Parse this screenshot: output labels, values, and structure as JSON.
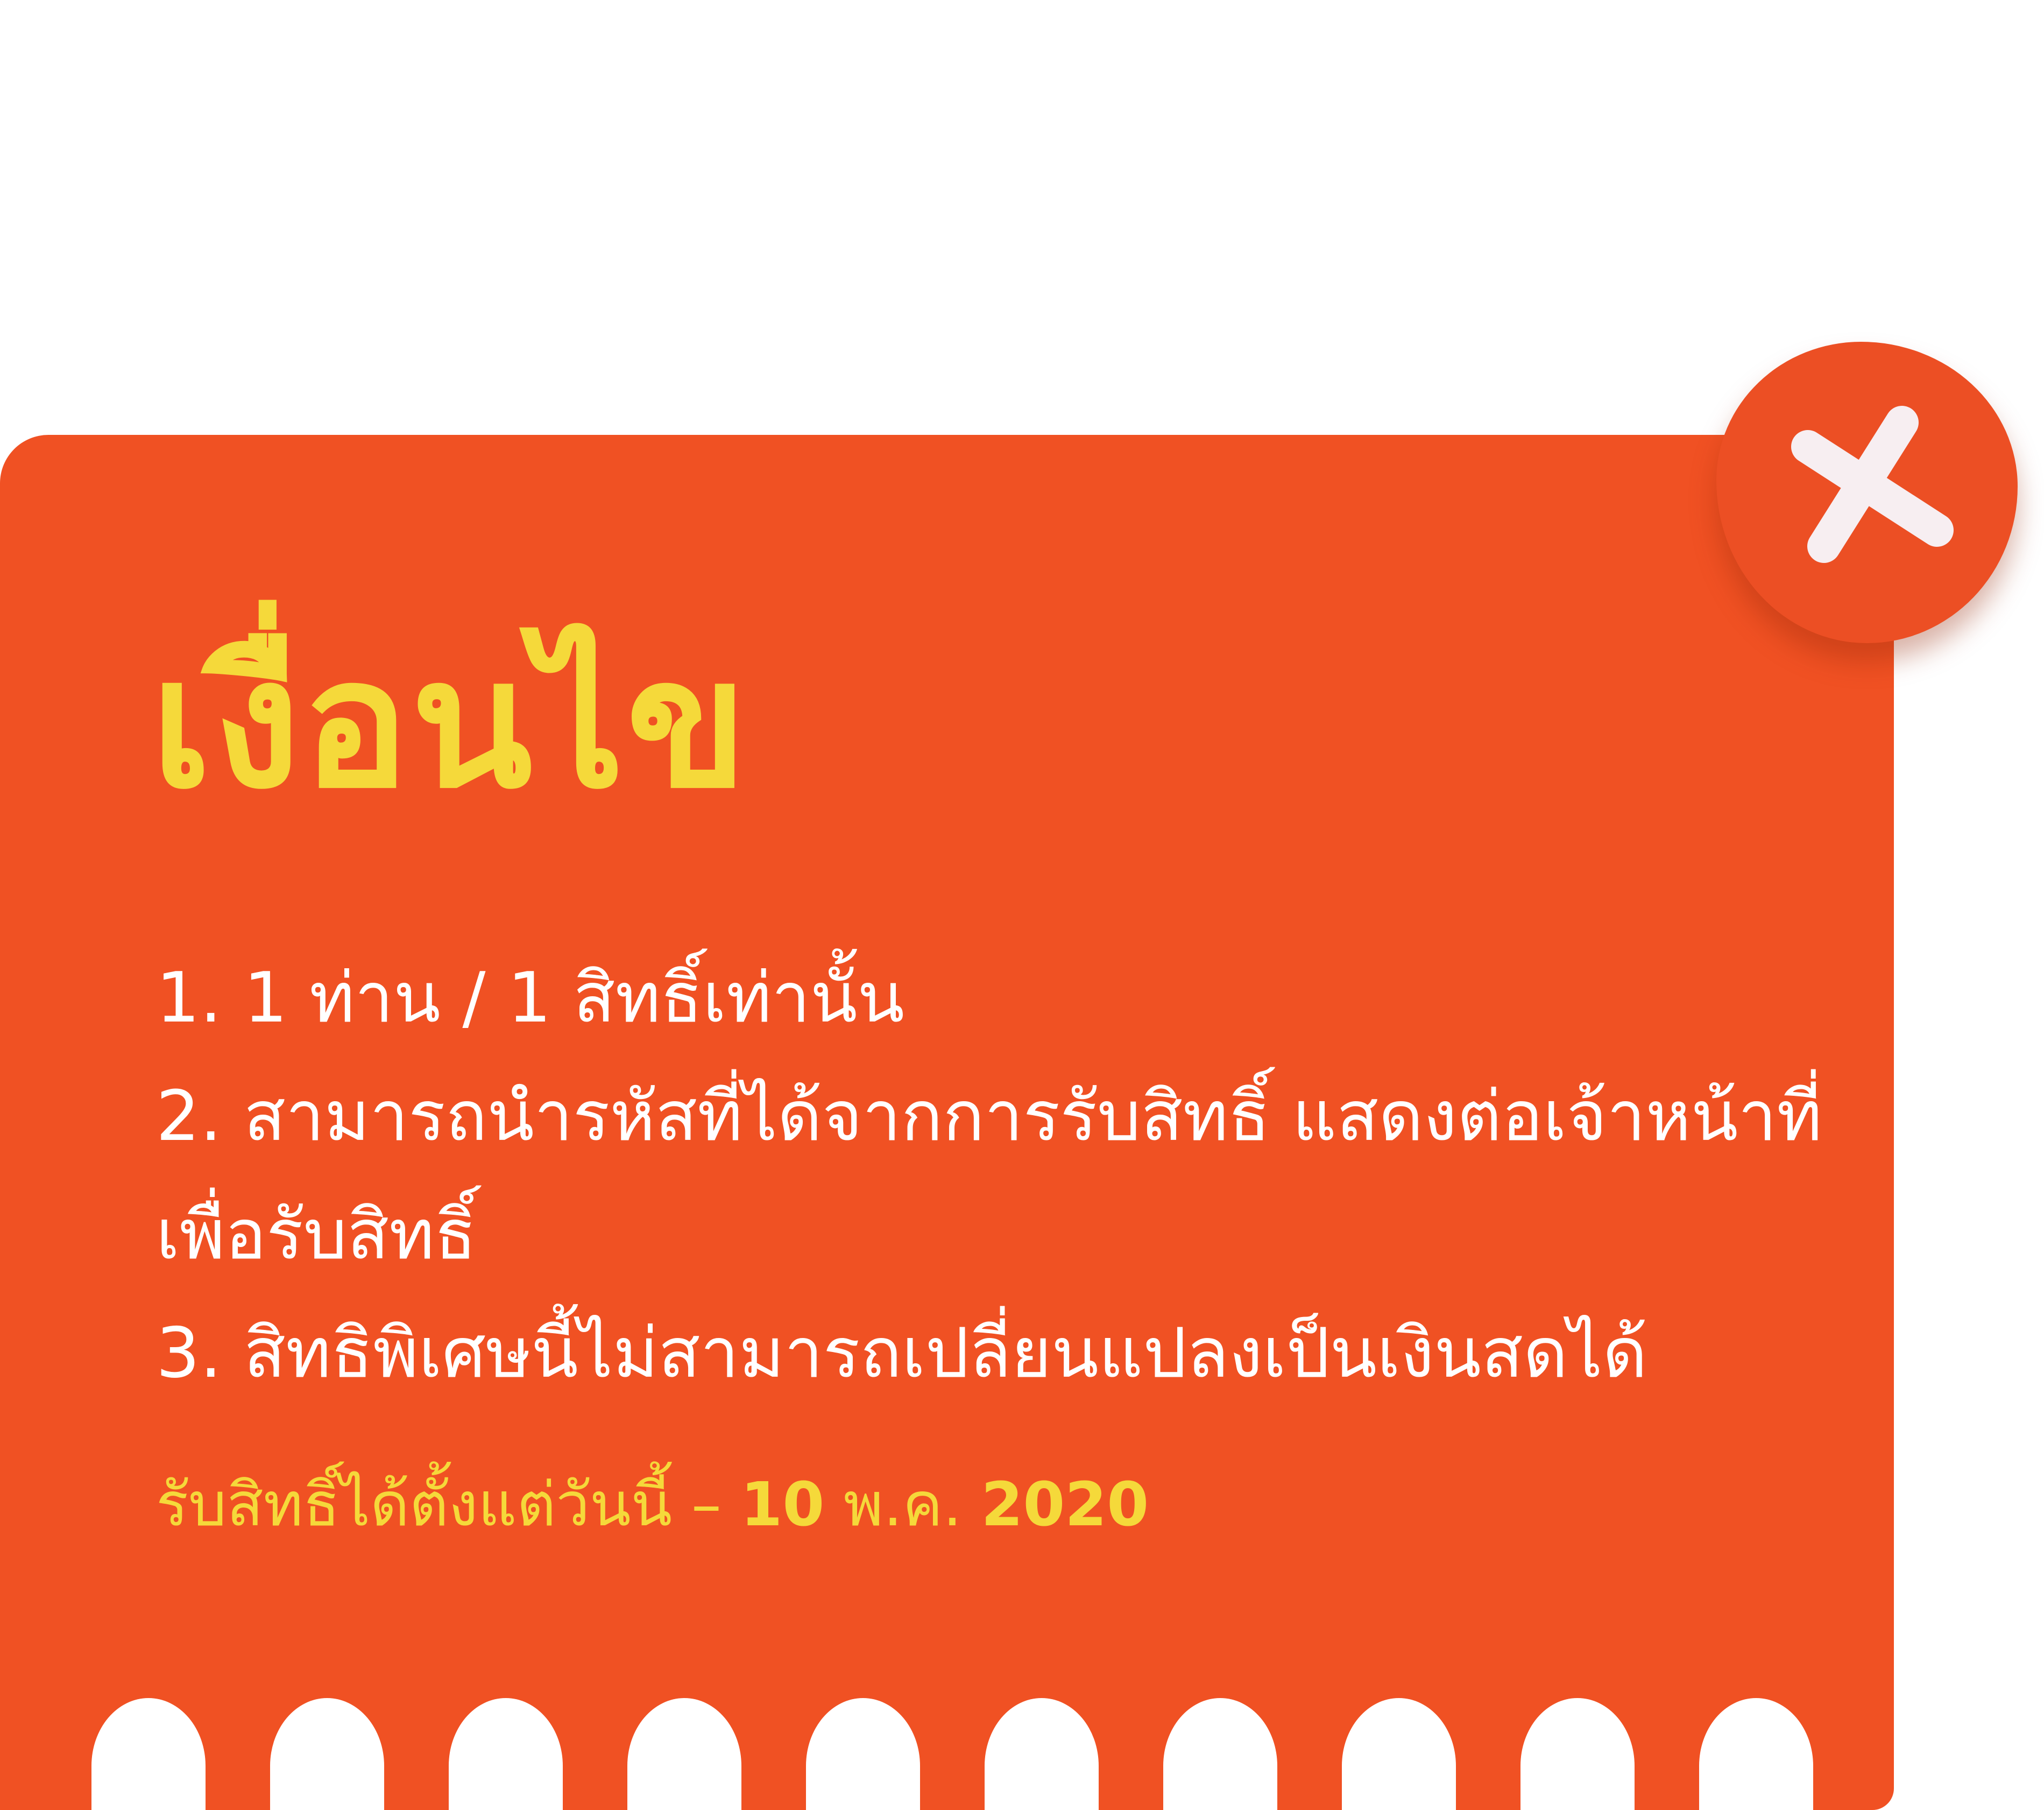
{
  "popup": {
    "title": "เงื่อนไข",
    "conditions": [
      "1. 1 ท่าน / 1 สิทธิ์เท่านั้น",
      "2. สามารถนำรหัสที่ได้จากการรับสิทธิ์ แสดงต่อเจ้าหน้าที่เพื่อรับสิทธิ์",
      "3. สิทธิพิเศษนี้ไม่สามารถเปลี่ยนแปลงเป็นเงินสดได้"
    ],
    "validity": {
      "prefix": "รับสิทธิ์ได้ตั้งแต่วันนี้ – ",
      "day": "10",
      "month": " พ.ค. ",
      "year": "2020"
    },
    "close_icon": "close-icon",
    "colors": {
      "card": "#f05123",
      "accent": "#f5d93a",
      "text": "#ffffff",
      "close_mark": "#f7eef1"
    }
  }
}
